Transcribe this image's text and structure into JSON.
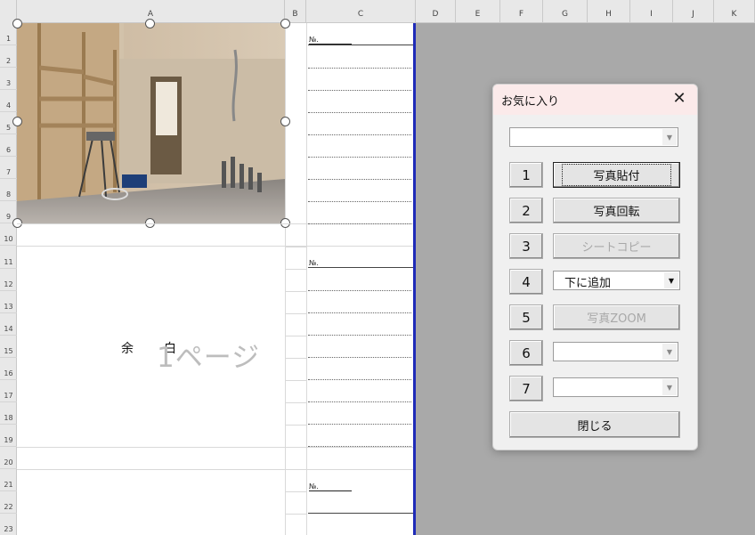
{
  "columns": [
    "A",
    "B",
    "C",
    "D",
    "E",
    "F",
    "G",
    "H",
    "I",
    "J",
    "K"
  ],
  "rows": [
    "1",
    "2",
    "3",
    "4",
    "5",
    "6",
    "7",
    "8",
    "9",
    "10",
    "11",
    "12",
    "13",
    "14",
    "15",
    "16",
    "17",
    "18",
    "19",
    "20",
    "21",
    "22",
    "23"
  ],
  "sheet": {
    "no_label": "№.",
    "yohaku_left": "余",
    "yohaku_right": "白",
    "page_label": "1ページ"
  },
  "dialog": {
    "title": "お気に入り",
    "close_glyph": "✕",
    "top_combo_value": "",
    "buttons": [
      {
        "num": "1",
        "label": "写真貼付",
        "kind": "button",
        "state": "focused"
      },
      {
        "num": "2",
        "label": "写真回転",
        "kind": "button",
        "state": "normal"
      },
      {
        "num": "3",
        "label": "シートコピー",
        "kind": "button",
        "state": "disabled"
      },
      {
        "num": "4",
        "label": "下に追加",
        "kind": "combo",
        "state": "normal"
      },
      {
        "num": "5",
        "label": "写真ZOOM",
        "kind": "button",
        "state": "disabled"
      },
      {
        "num": "6",
        "label": "",
        "kind": "combo",
        "state": "disabled"
      },
      {
        "num": "7",
        "label": "",
        "kind": "combo",
        "state": "disabled"
      }
    ],
    "close_label": "閉じる"
  },
  "icons": {
    "dropdown": "chevron-down-icon",
    "close": "close-icon"
  },
  "colors": {
    "accent_border": "#1f2bb8",
    "dialog_title_bg": "#fbeaea"
  }
}
